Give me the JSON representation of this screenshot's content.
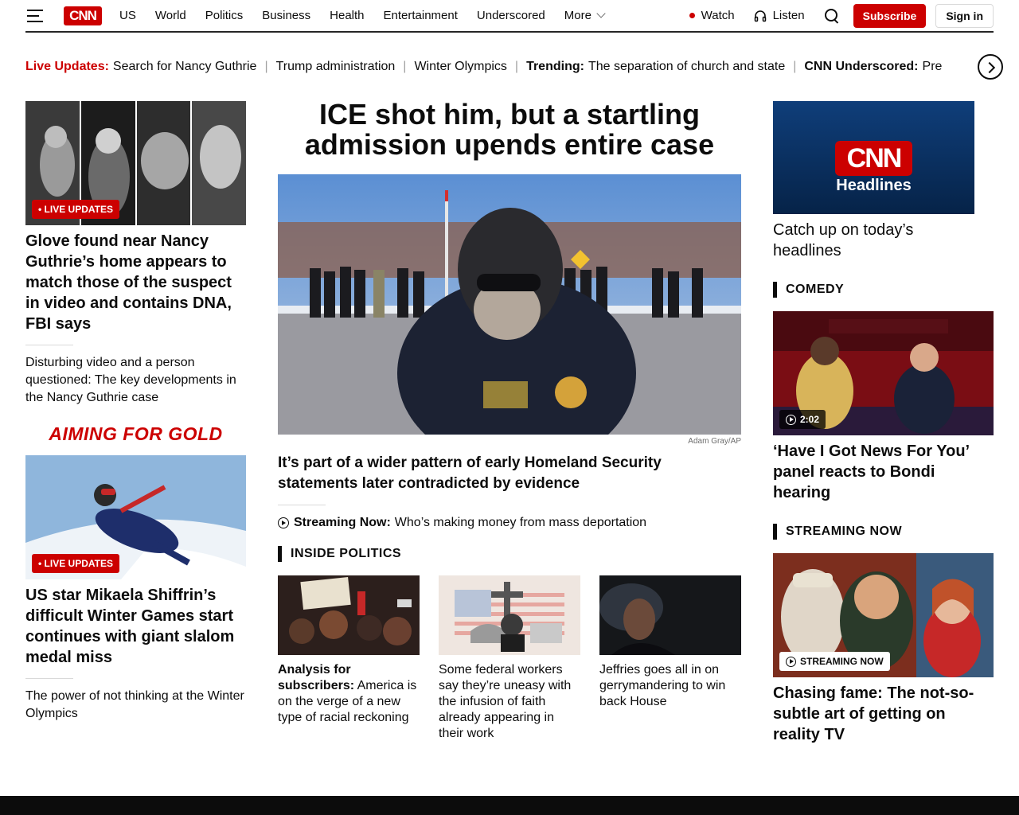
{
  "header": {
    "logo": "CNN",
    "nav": [
      "US",
      "World",
      "Politics",
      "Business",
      "Health",
      "Entertainment",
      "Underscored"
    ],
    "more": "More",
    "watch": "Watch",
    "listen": "Listen",
    "subscribe": "Subscribe",
    "signin": "Sign in"
  },
  "ticker": {
    "live_label": "Live Updates:",
    "items": [
      "Search for Nancy Guthrie",
      "Trump administration",
      "Winter Olympics"
    ],
    "trending_label": "Trending:",
    "trending_text": "The separation of church and state",
    "underscored_label": "CNN Underscored:",
    "underscored_text": "Pre"
  },
  "left": {
    "story1": {
      "badge": "• LIVE UPDATES",
      "headline": "Glove found near Nancy Guthrie’s home appears to match those of the suspect in video and contains DNA, FBI says",
      "sub": "Disturbing video and a person questioned: The key developments in the Nancy Guthrie case"
    },
    "aiming_logo": "AIMING FOR GOLD",
    "story2": {
      "badge": "• LIVE UPDATES",
      "headline": "US star Mikaela Shiffrin’s difficult Winter Games start continues with giant slalom medal miss",
      "sub": "The power of not thinking at the Winter Olympics"
    }
  },
  "center": {
    "title": "ICE shot him, but a startling admission upends entire case",
    "credit": "Adam Gray/AP",
    "sub": "It’s part of a wider pattern of early Homeland Security statements later contradicted by evidence",
    "streaming_label": "Streaming Now:",
    "streaming_text": "Who’s making money from mass deportation",
    "section": "INSIDE POLITICS",
    "cards": [
      {
        "label": "Analysis for subscribers:",
        "text": "America is on the verge of a new type of racial reckoning"
      },
      {
        "label": "",
        "text": "Some federal workers say they’re uneasy with the infusion of faith already appearing in their work"
      },
      {
        "label": "",
        "text": "Jeffries goes all in on gerrymandering to win back House"
      }
    ]
  },
  "right": {
    "headlines_logo": "CNN",
    "headlines_word": "Headlines",
    "headlines_caption": "Catch up on today’s headlines",
    "comedy_section": "COMEDY",
    "comedy_duration": "2:02",
    "comedy_headline": "‘Have I Got News For You’ panel reacts to Bondi hearing",
    "streaming_section": "STREAMING NOW",
    "streaming_badge": "STREAMING NOW",
    "streaming_headline": "Chasing fame: The not-so-subtle art of getting on reality TV"
  }
}
